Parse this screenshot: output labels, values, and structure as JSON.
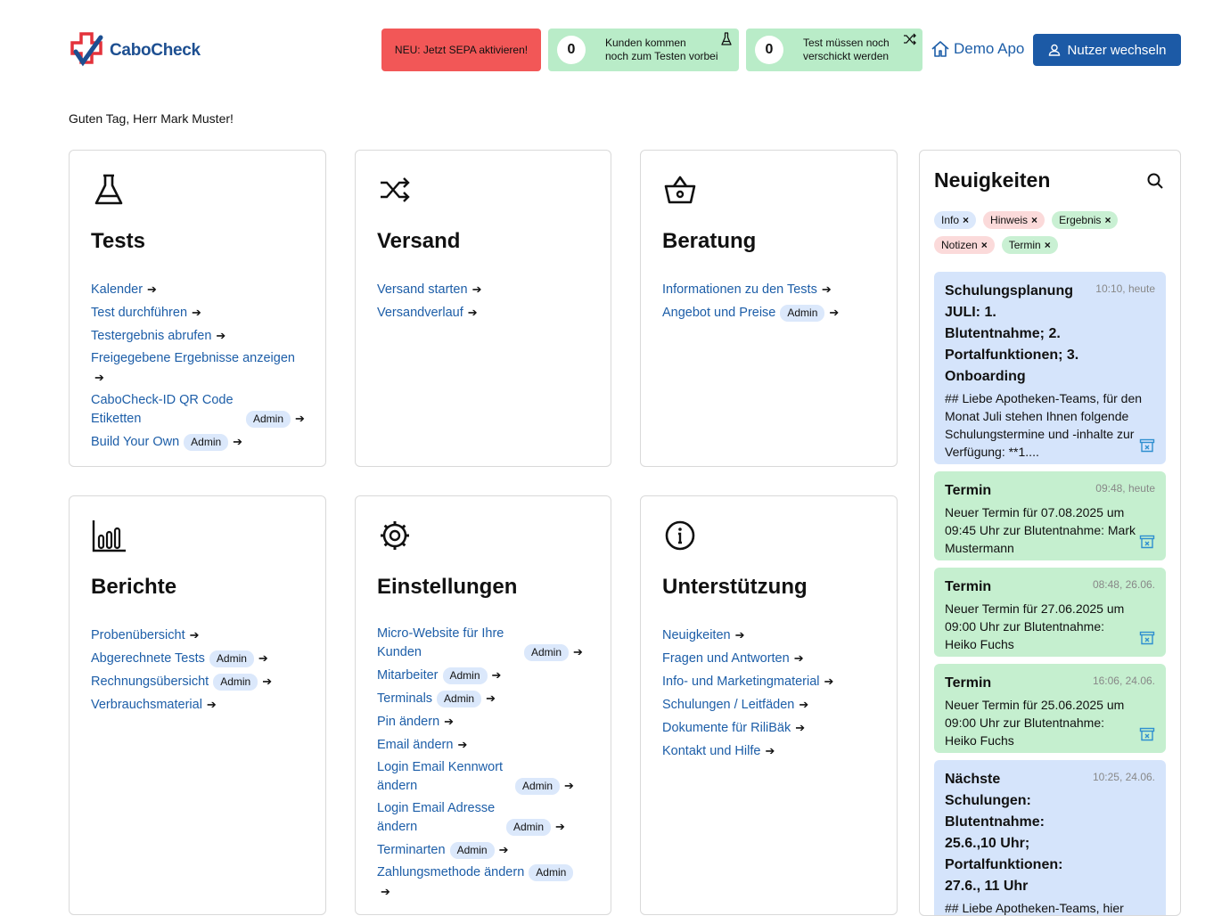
{
  "header": {
    "logo_text": "CaboCheck",
    "sepa_label": "NEU: Jetzt SEPA aktivieren!",
    "counters": [
      {
        "value": "0",
        "line1": "Kunden kommen",
        "line2": "noch zum Testen vorbei",
        "icon": "flask-icon"
      },
      {
        "value": "0",
        "line1": "Test müssen noch",
        "line2": "verschickt werden",
        "icon": "shuffle-icon"
      }
    ],
    "pharmacy": "Demo Apo",
    "switch_user": "Nutzer wechseln"
  },
  "greeting": "Guten Tag, Herr Mark Muster!",
  "admin_badge": "Admin",
  "cards": {
    "tests": {
      "title": "Tests",
      "links": [
        "Kalender",
        "Test durchführen",
        "Testergebnis abrufen",
        "Freigegebene Ergebnisse anzeigen",
        "CaboCheck-ID QR Code Etiketten",
        "Build Your Own"
      ]
    },
    "versand": {
      "title": "Versand",
      "links": [
        "Versand starten",
        "Versandverlauf"
      ]
    },
    "beratung": {
      "title": "Beratung",
      "links": [
        "Informationen zu den Tests",
        "Angebot und Preise"
      ]
    },
    "berichte": {
      "title": "Berichte",
      "links": [
        "Probenübersicht",
        "Abgerechnete Tests",
        "Rechnungsübersicht",
        "Verbrauchsmaterial"
      ]
    },
    "einstellungen": {
      "title": "Einstellungen",
      "links": [
        "Micro-Website für Ihre Kunden",
        "Mitarbeiter",
        "Terminals",
        "Pin ändern",
        "Email ändern",
        "Login Email Kennwort ändern",
        "Login Email Adresse ändern",
        "Terminarten",
        "Zahlungsmethode ändern"
      ]
    },
    "unterstuetzung": {
      "title": "Unterstützung",
      "links": [
        "Neuigkeiten",
        "Fragen und Antworten",
        "Info- und Marketingmaterial",
        "Schulungen / Leitfäden",
        "Dokumente für RiliBäk",
        "Kontakt und Hilfe"
      ]
    }
  },
  "news": {
    "title": "Neuigkeiten",
    "tags": [
      {
        "label": "Info",
        "color": "#dbe8fb"
      },
      {
        "label": "Hinweis",
        "color": "#fbdada"
      },
      {
        "label": "Ergebnis",
        "color": "#c9f0d3"
      },
      {
        "label": "Notizen",
        "color": "#fbdada"
      },
      {
        "label": "Termin",
        "color": "#c9f0d3"
      }
    ],
    "items": [
      {
        "title": "Schulungsplanung JULI: 1. Blutentnahme; 2. Portalfunktionen; 3. Onboarding",
        "time": "10:10, heute",
        "body": "## Liebe Apotheken-Teams, für den Monat Juli stehen Ihnen folgende Schulungstermine und -inhalte zur Verfügung: **1...."
      },
      {
        "title": "Termin",
        "time": "09:48, heute",
        "body": "Neuer Termin für 07.08.2025 um 09:45 Uhr zur Blutentnahme: Mark Mustermann"
      },
      {
        "title": "Termin",
        "time": "08:48, 26.06.",
        "body": "Neuer Termin für 27.06.2025 um 09:00 Uhr zur Blutentnahme: Heiko Fuchs"
      },
      {
        "title": "Termin",
        "time": "16:06, 24.06.",
        "body": "Neuer Termin für 25.06.2025 um 09:00 Uhr zur Blutentnahme: Heiko Fuchs"
      },
      {
        "title": "Nächste Schulungen: Blutentnahme: 25.6.,10 Uhr; Portalfunktionen: 27.6., 11 Uhr",
        "time": "10:25, 24.06.",
        "body": "## Liebe Apotheken-Teams, hier"
      }
    ]
  }
}
